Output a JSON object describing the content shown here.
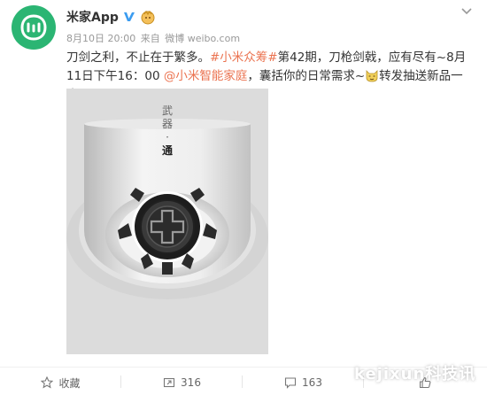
{
  "user": {
    "name": "米家App",
    "avatar_color": "#2bb573",
    "verified_icon": "verified-v-icon",
    "badge_icon": "member-badge-icon"
  },
  "meta": {
    "time": "8月10日 20:00",
    "source_prefix": "来自",
    "source": "微博 weibo.com"
  },
  "post": {
    "part1": "刀剑之利，不止在于繁多。",
    "hashtag": "#小米众筹#",
    "part2": "第42期，刀枪剑戟，应有尽有~8月11日下午16：00 ",
    "mention": "@小米智能家庭",
    "part3": "，囊括你的日常需求~",
    "part4": "转发抽送新品一个！",
    "heart": "❤",
    "link_color": "#eb7350"
  },
  "image": {
    "vertical_text_1": "武",
    "vertical_text_2": "器",
    "vertical_text_dot": "·",
    "vertical_text_3": "通"
  },
  "footer": {
    "favorite_label": "收藏",
    "repost_count": "316",
    "comment_count": "1⁠63"
  },
  "watermark": "kejixun科技讯"
}
